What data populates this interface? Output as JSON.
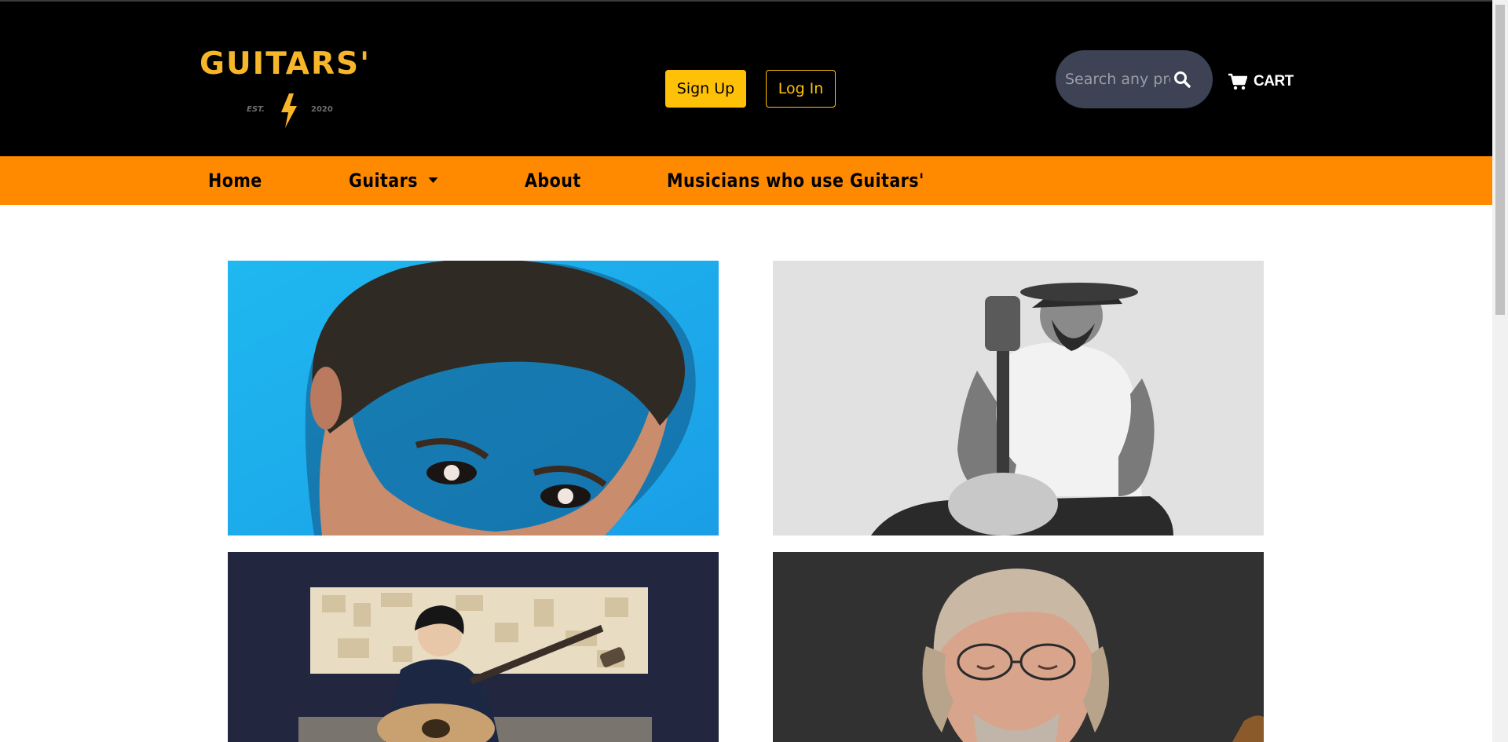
{
  "brand": {
    "wordmark": "GUITARS'",
    "est_label": "EST.",
    "year": "2020",
    "colors": {
      "primary": "#f7b62a",
      "accent": "#ff8a00",
      "header_bg": "#000000"
    }
  },
  "auth": {
    "signup_label": "Sign Up",
    "login_label": "Log In"
  },
  "search": {
    "placeholder": "Search any product",
    "icon": "search-icon"
  },
  "cart": {
    "label": "CART",
    "icon": "cart-icon"
  },
  "nav": {
    "items": [
      {
        "label": "Home"
      },
      {
        "label": "Guitars",
        "has_dropdown": true
      },
      {
        "label": "About"
      },
      {
        "label": "Musicians who use Guitars'"
      }
    ]
  },
  "gallery": {
    "photos": [
      {
        "subject": "musician-portrait-1",
        "style": "color, blue background"
      },
      {
        "subject": "musician-portrait-2",
        "style": "black and white, with guitar"
      },
      {
        "subject": "musician-portrait-3",
        "style": "color, playing acoustic guitar in studio"
      },
      {
        "subject": "musician-portrait-4",
        "style": "color, dark background"
      }
    ]
  }
}
